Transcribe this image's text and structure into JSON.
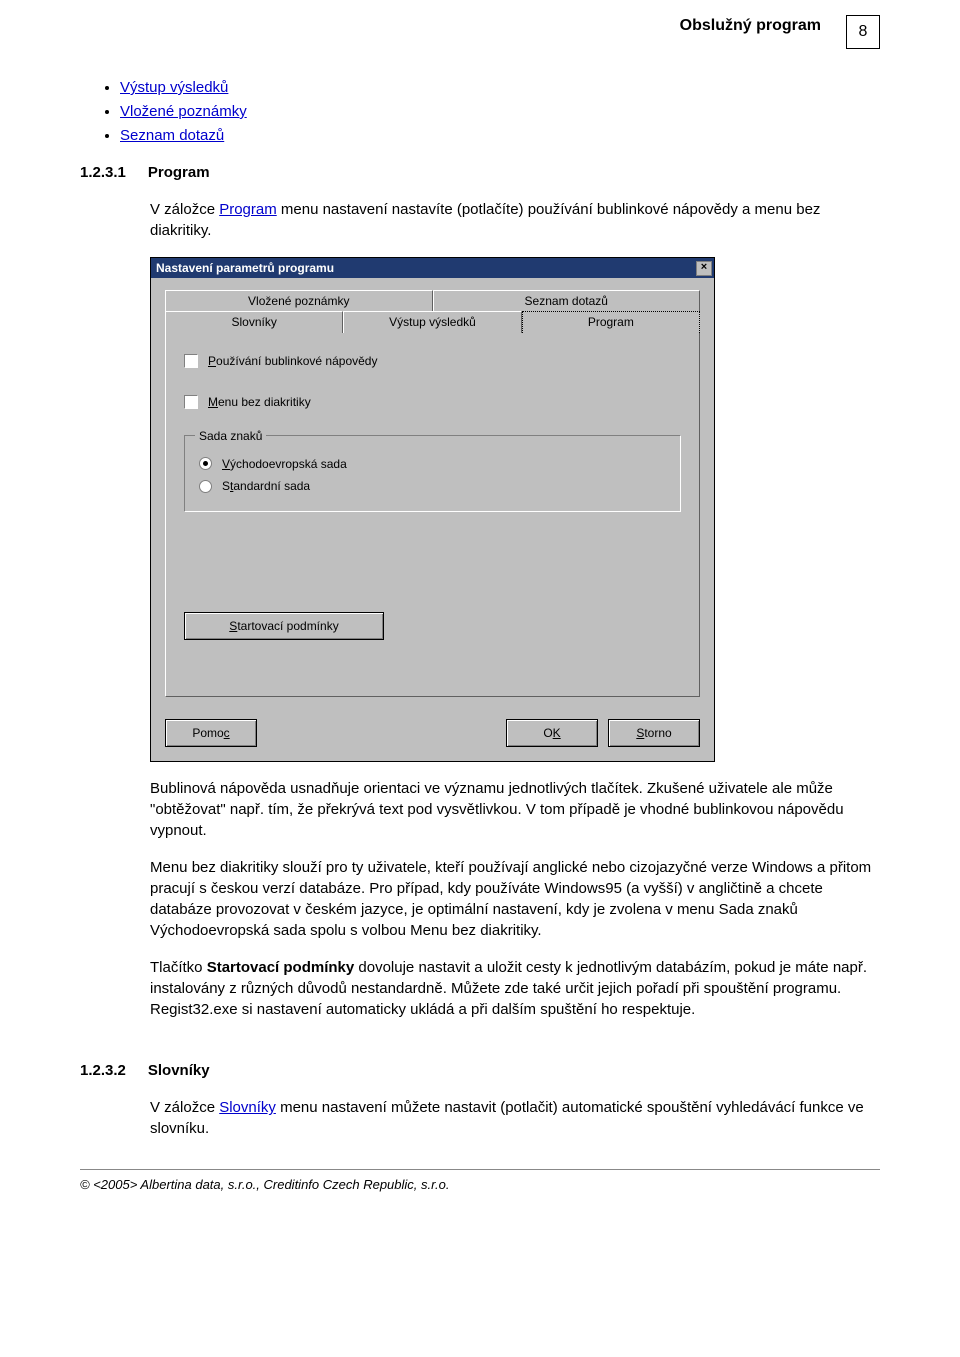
{
  "header": {
    "title": "Obslužný program",
    "page_num": "8"
  },
  "bullets": [
    {
      "label": "Výstup výsledků"
    },
    {
      "label": "Vložené poznámky"
    },
    {
      "label": "Seznam dotazů"
    }
  ],
  "sec1": {
    "num": "1.2.3.1",
    "title": "Program",
    "intro_a": "V záložce ",
    "intro_link": "Program",
    "intro_b": " menu nastavení nastavíte (potlačíte) používání bublinkové nápovědy a menu bez diakritiky."
  },
  "dialog": {
    "title": "Nastavení parametrů programu",
    "close": "×",
    "tabs_back": [
      "Vložené poznámky",
      "Seznam dotazů"
    ],
    "tabs_front": [
      "Slovníky",
      "Výstup výsledků",
      "Program"
    ],
    "chk_bubble": "Používání bublinkové nápovědy",
    "chk_menu": "Menu bez diakritiky",
    "group_title": "Sada znaků",
    "radio1": "Východoevropská sada",
    "radio2": "Standardní sada",
    "btn_start": "Startovací podmínky",
    "btn_help": "Pomoc",
    "btn_ok": "OK",
    "btn_cancel": "Storno"
  },
  "para1": "Bublinová nápověda usnadňuje orientaci ve významu jednotlivých tlačítek. Zkušené uživatele ale může \"obtěžovat\" např. tím, že překrývá text pod vysvětlivkou. V tom případě je vhodné bublinkovou nápovědu vypnout.",
  "para2": "Menu bez diakritiky slouží pro ty uživatele, kteří používají anglické nebo cizojazyčné verze Windows a přitom pracují s českou verzí databáze. Pro případ, kdy používáte Windows95 (a vyšší) v angličtině a chcete databáze provozovat v českém jazyce, je optimální nastavení, kdy je zvolena v menu Sada znaků Východoevropská sada spolu s volbou Menu bez diakritiky.",
  "para3a": "Tlačítko ",
  "para3bold": "Startovací podmínky",
  "para3b": " dovoluje nastavit a uložit cesty k jednotlivým databázím, pokud je máte např. instalovány z různých důvodů nestandardně. Můžete zde také určit jejich pořadí při spouštění programu. Regist32.exe si nastavení automaticky ukládá a při dalším spuštění ho respektuje.",
  "sec2": {
    "num": "1.2.3.2",
    "title": "Slovníky",
    "body_a": "V záložce ",
    "body_link": "Slovníky",
    "body_b": " menu nastavení můžete nastavit (potlačit) automatické spouštění vyhledávácí funkce ve slovníku."
  },
  "footer": "© <2005> Albertina data, s.r.o., Creditinfo Czech Republic, s.r.o."
}
